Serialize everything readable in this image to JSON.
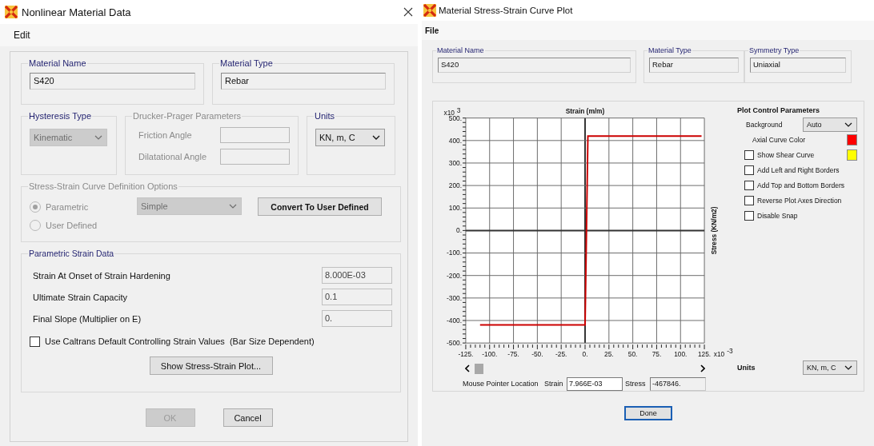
{
  "left_window": {
    "title": "Nonlinear Material Data",
    "menu": [
      "Edit"
    ],
    "material_name": {
      "label": "Material Name",
      "value": "S420"
    },
    "material_type": {
      "label": "Material Type",
      "value": "Rebar"
    },
    "hysteresis": {
      "label": "Hysteresis Type",
      "value": "Kinematic",
      "disabled": true
    },
    "drucker_prager": {
      "label": "Drucker-Prager Parameters",
      "disabled": true,
      "fields": [
        {
          "label": "Friction Angle"
        },
        {
          "label": "Dilatational Angle"
        }
      ]
    },
    "units": {
      "label": "Units",
      "value": "KN, m, C"
    },
    "curve_options": {
      "label": "Stress-Strain Curve Definition Options",
      "disabled": true,
      "radios": [
        {
          "label": "Parametric",
          "selected": true
        },
        {
          "label": "User Defined",
          "selected": false
        }
      ],
      "curve_select": {
        "value": "Simple",
        "disabled": true
      },
      "convert_button": "Convert To User Defined"
    },
    "parametric": {
      "label": "Parametric Strain Data",
      "rows": [
        {
          "label": "Strain At Onset of Strain Hardening",
          "value": "8.000E-03"
        },
        {
          "label": "Ultimate Strain Capacity",
          "value": "0.1"
        },
        {
          "label": "Final Slope (Multiplier on E)",
          "value": "0."
        }
      ],
      "caltrans": {
        "label": "Use Caltrans Default Controlling Strain Values  (Bar Size Dependent)",
        "checked": false
      },
      "plot_button": "Show Stress-Strain Plot..."
    },
    "buttons": [
      {
        "label": "OK",
        "disabled": true
      },
      {
        "label": "Cancel",
        "disabled": false
      }
    ]
  },
  "right_window": {
    "title": "Material Stress-Strain Curve Plot",
    "menu": [
      "File"
    ],
    "material_name": {
      "label": "Material Name",
      "value": "S420"
    },
    "material_type": {
      "label": "Material Type",
      "value": "Rebar"
    },
    "symmetry_type": {
      "label": "Symmetry Type",
      "value": "Uniaxial"
    },
    "chart_data": {
      "type": "line",
      "xlabel": "Strain  (m/m)",
      "ylabel": "Stress   (KN/m2)",
      "x": [
        -110,
        0,
        3,
        122
      ],
      "series": [
        {
          "color": "#cc0000",
          "values": [
            -420,
            -420,
            420,
            420
          ]
        }
      ],
      "grid": true,
      "xlim": [
        -125,
        125
      ],
      "ylim": [
        -500,
        500
      ],
      "xticks": [
        {
          "value": -125,
          "label": "-125."
        },
        {
          "value": -100,
          "label": "-100."
        },
        {
          "value": -75,
          "label": "-75."
        },
        {
          "value": -50,
          "label": "-50."
        },
        {
          "value": -25,
          "label": "-25."
        },
        {
          "value": 0,
          "label": "0."
        },
        {
          "value": 25,
          "label": "25."
        },
        {
          "value": 50,
          "label": "50."
        },
        {
          "value": 75,
          "label": "75."
        },
        {
          "value": 100,
          "label": "100."
        },
        {
          "value": 125,
          "label": "125."
        }
      ],
      "yticks": [
        {
          "value": 500,
          "label": "500."
        },
        {
          "value": 400,
          "label": "400."
        },
        {
          "value": 300,
          "label": "300."
        },
        {
          "value": 200,
          "label": "200."
        },
        {
          "value": 100,
          "label": "100."
        },
        {
          "value": 0,
          "label": "0."
        },
        {
          "value": -100,
          "label": "-100."
        },
        {
          "value": -200,
          "label": "-200."
        },
        {
          "value": -300,
          "label": "-300."
        },
        {
          "value": -400,
          "label": "-400."
        },
        {
          "value": -500,
          "label": "-500."
        }
      ]
    },
    "y_multiplier": {
      "base": "x10",
      "exponent": "3"
    },
    "x_multiplier": {
      "base": "x10",
      "exponent": "-3"
    },
    "mouse_pointer": {
      "label": "Mouse Pointer Location",
      "strain_label": "Strain",
      "strain_value": "7.966E-03",
      "stress_label": "Stress",
      "stress_value": "-467846."
    },
    "plot_control": {
      "title": "Plot Control Parameters",
      "background": {
        "label": "Background",
        "value": "Auto"
      },
      "rows": [
        {
          "kind": "color",
          "label": "Axial Curve Color",
          "color": "#ff0000"
        },
        {
          "kind": "check",
          "label": "Show Shear Curve",
          "checked": false,
          "color": "#ffff00"
        },
        {
          "kind": "check",
          "label": "Add Left and Right Borders",
          "checked": false
        },
        {
          "kind": "check",
          "label": "Add Top and Bottom Borders",
          "checked": false
        },
        {
          "kind": "check",
          "label": "Reverse Plot Axes Direction",
          "checked": false
        },
        {
          "kind": "check",
          "label": "Disable Snap",
          "checked": false
        }
      ]
    },
    "units": {
      "label": "Units",
      "value": "KN, m, C"
    },
    "done_button": "Done"
  }
}
